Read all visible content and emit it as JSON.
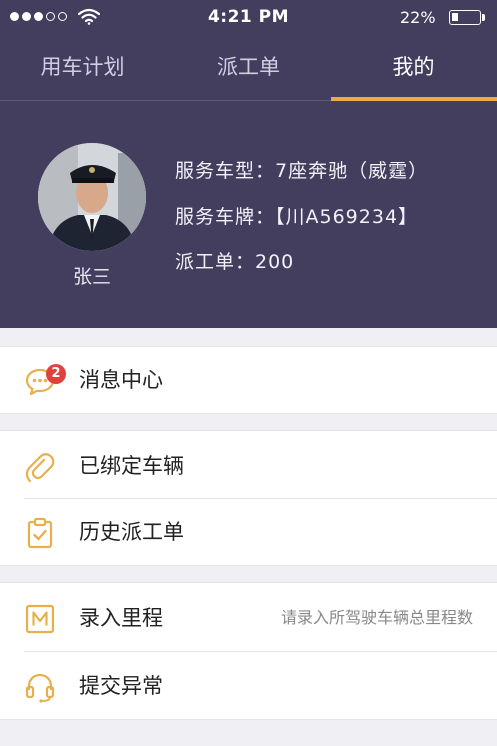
{
  "status_bar": {
    "time": "4:21 PM",
    "battery_percent": "22%",
    "battery_level": 0.22,
    "signal_bars_filled": 3,
    "signal_bars_total": 5
  },
  "tabs": [
    {
      "label": "用车计划",
      "active": false
    },
    {
      "label": "派工单",
      "active": false
    },
    {
      "label": "我的",
      "active": true
    }
  ],
  "profile": {
    "name": "张三",
    "vehicle_type": "服务车型：7座奔驰（威霆）",
    "vehicle_plate": "服务车牌：【川A569234】",
    "dispatch_count": "派工单：200"
  },
  "menu": {
    "messages": {
      "label": "消息中心",
      "badge": "2",
      "icon": "chat-bubble-icon"
    },
    "bound_vehicles": {
      "label": "已绑定车辆",
      "icon": "paperclip-icon"
    },
    "history_orders": {
      "label": "历史派工单",
      "icon": "clipboard-check-icon"
    },
    "mileage": {
      "label": "录入里程",
      "hint": "请录入所驾驶车辆总里程数",
      "icon": "m-box-icon"
    },
    "report_issue": {
      "label": "提交异常",
      "icon": "headset-icon"
    }
  },
  "colors": {
    "header_bg": "#433d5e",
    "accent": "#f0a945",
    "icon": "#e8b04a",
    "badge": "#e0413c",
    "page_bg": "#efeff4"
  }
}
